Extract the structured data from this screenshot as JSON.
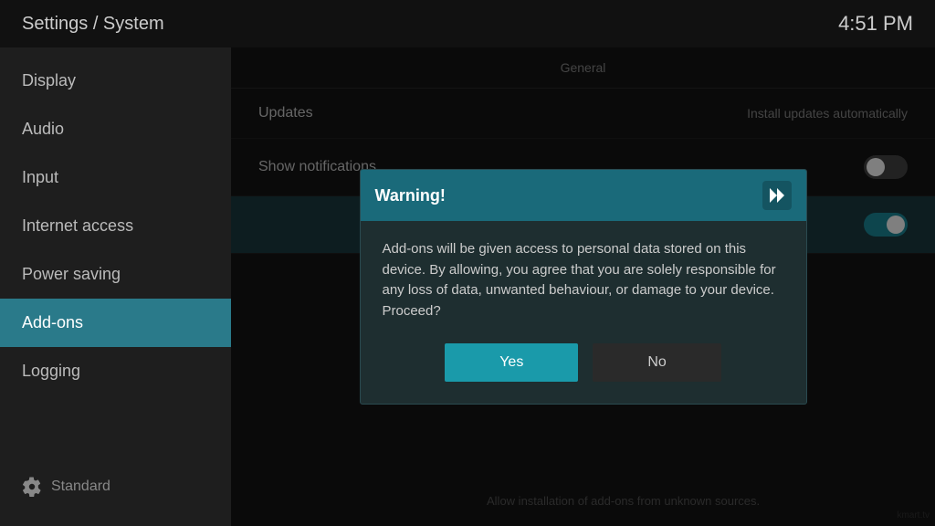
{
  "header": {
    "title": "Settings / System",
    "time": "4:51 PM"
  },
  "sidebar": {
    "items": [
      {
        "id": "display",
        "label": "Display",
        "active": false
      },
      {
        "id": "audio",
        "label": "Audio",
        "active": false
      },
      {
        "id": "input",
        "label": "Input",
        "active": false
      },
      {
        "id": "internet-access",
        "label": "Internet access",
        "active": false
      },
      {
        "id": "power-saving",
        "label": "Power saving",
        "active": false
      },
      {
        "id": "add-ons",
        "label": "Add-ons",
        "active": true
      },
      {
        "id": "logging",
        "label": "Logging",
        "active": false
      }
    ],
    "bottom_item": {
      "label": "Standard",
      "icon": "gear-icon"
    }
  },
  "content": {
    "section_label": "General",
    "rows": [
      {
        "label": "Updates",
        "value": "Install updates automatically",
        "has_toggle": false
      },
      {
        "label": "Show notifications",
        "value": "",
        "has_toggle": true,
        "toggle_state": "off"
      },
      {
        "label": "",
        "value": "",
        "has_toggle": true,
        "toggle_state": "on",
        "is_highlighted": true
      }
    ],
    "footer_note": "Allow installation of add-ons from unknown sources."
  },
  "dialog": {
    "title": "Warning!",
    "body": "Add-ons will be given access to personal data stored on this device. By allowing, you agree that you are solely responsible for any loss of data, unwanted behaviour, or damage to your device. Proceed?",
    "buttons": {
      "yes": "Yes",
      "no": "No"
    }
  }
}
